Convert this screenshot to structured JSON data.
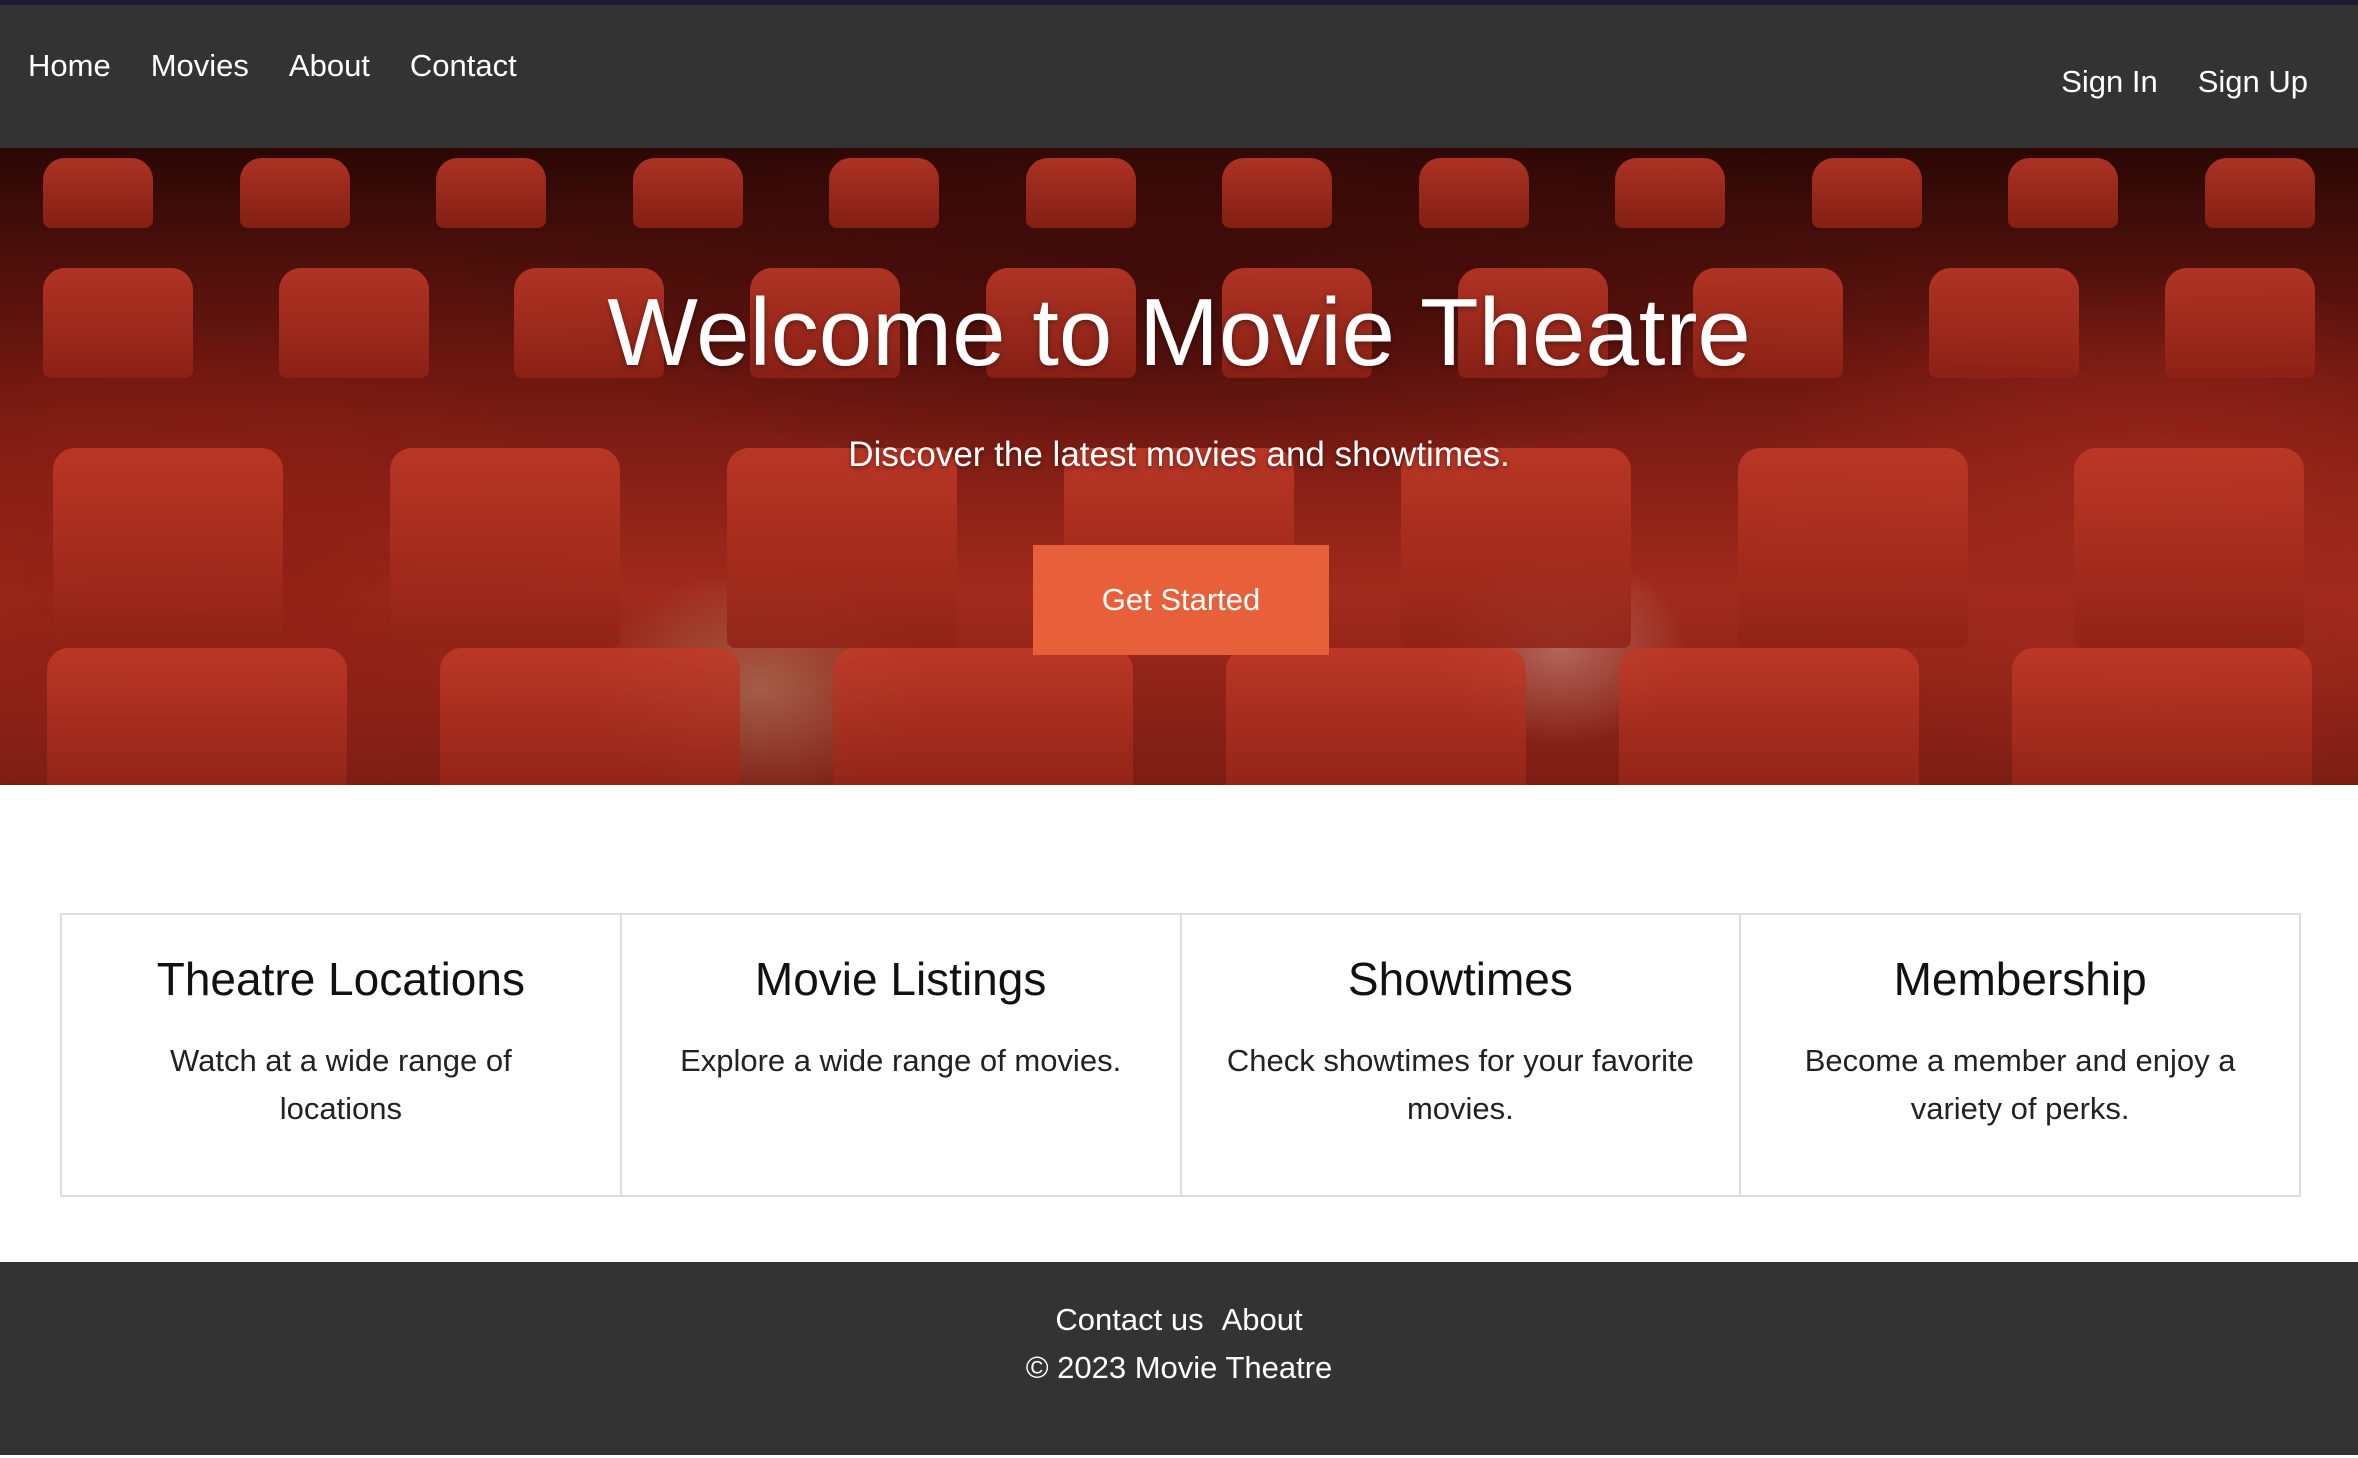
{
  "nav": {
    "left_links": [
      "Home",
      "Movies",
      "About",
      "Contact"
    ],
    "right_links": [
      "Sign In",
      "Sign Up"
    ]
  },
  "hero": {
    "title": "Welcome to Movie Theatre",
    "subtitle": "Discover the latest movies and showtimes.",
    "cta_label": "Get Started",
    "cta_color": "#e8603a"
  },
  "features": [
    {
      "title": "Theatre Locations",
      "text": "Watch at a wide range of locations"
    },
    {
      "title": "Movie Listings",
      "text": "Explore a wide range of movies."
    },
    {
      "title": "Showtimes",
      "text": "Check showtimes for your favorite movies."
    },
    {
      "title": "Membership",
      "text": "Become a member and enjoy a variety of perks."
    }
  ],
  "footer": {
    "links": [
      "Contact us",
      "About"
    ],
    "copyright": "© 2023 Movie Theatre"
  },
  "colors": {
    "navbar_bg": "#333333",
    "footer_bg": "#333333",
    "accent": "#e8603a"
  }
}
